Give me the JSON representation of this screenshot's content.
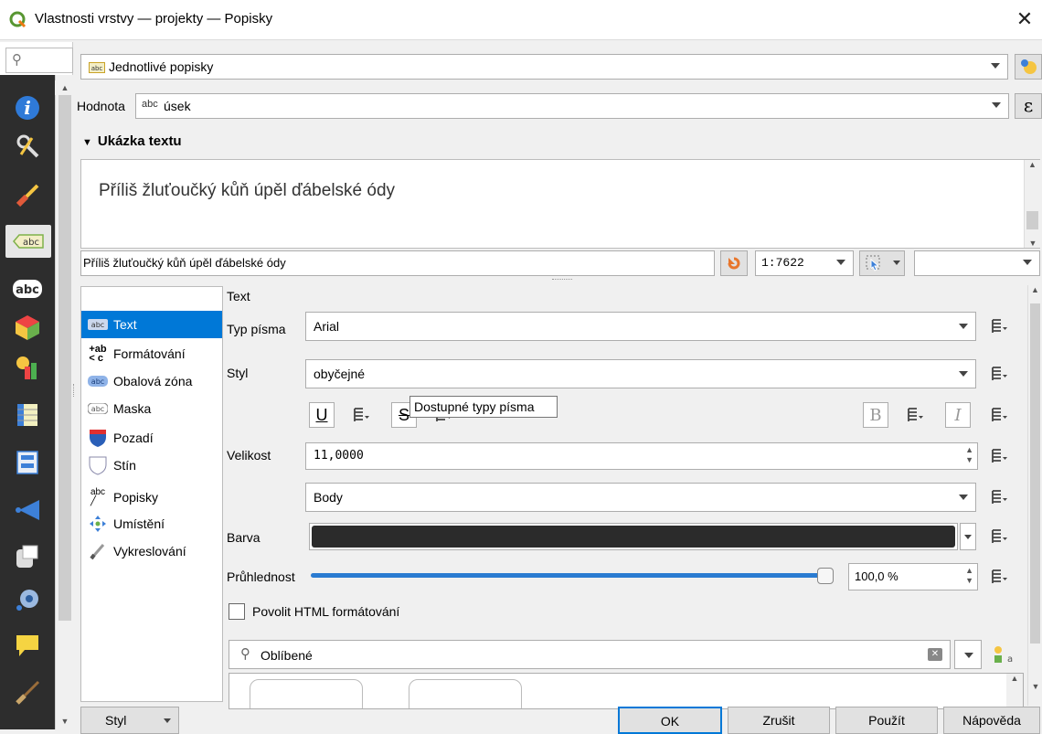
{
  "window": {
    "title": "Vlastnosti vrstvy — projekty — Popisky",
    "close_symbol": "✕"
  },
  "mode_combo": {
    "value": "Jednotlivé popisky"
  },
  "value_row": {
    "label": "Hodnota",
    "prefix": "abc",
    "value": "úsek",
    "expr_symbol": "ε"
  },
  "preview": {
    "heading": "Ukázka textu",
    "sample_text": "Příliš žluťoučký kůň úpěl ďábelské ódy",
    "input_value": "Příliš žluťoučký kůň úpěl ďábelské ódy",
    "scale": "1:7622"
  },
  "nav": {
    "items": [
      {
        "icon": "abc",
        "label": "Text"
      },
      {
        "icon": "+ab",
        "label": "Formátování"
      },
      {
        "icon": "abc",
        "label": "Obalová zóna"
      },
      {
        "icon": "abc",
        "label": "Maska"
      },
      {
        "icon": "shield",
        "label": "Pozadí"
      },
      {
        "icon": "shadow",
        "label": "Stín"
      },
      {
        "icon": "callout",
        "label": "Popisky"
      },
      {
        "icon": "move",
        "label": "Umístění"
      },
      {
        "icon": "brush",
        "label": "Vykreslování"
      }
    ]
  },
  "text_panel": {
    "section": "Text",
    "font_label": "Typ písma",
    "font_value": "Arial",
    "style_label": "Styl",
    "style_value": "obyčejné",
    "underline": "U",
    "strike": "S",
    "bold": "B",
    "italic": "I",
    "tooltip": "Dostupné typy písma",
    "size_label": "Velikost",
    "size_value": "11,0000",
    "unit_value": "Body",
    "color_label": "Barva",
    "color_value": "#2b2b2b",
    "opacity_label": "Průhlednost",
    "opacity_value": "100,0 %",
    "opacity_fraction": 1.0,
    "html_label": "Povolit HTML formátování",
    "favorites_placeholder": "Oblíbené"
  },
  "buttons": {
    "style": "Styl",
    "ok": "OK",
    "cancel": "Zrušit",
    "apply": "Použít",
    "help": "Nápověda"
  }
}
